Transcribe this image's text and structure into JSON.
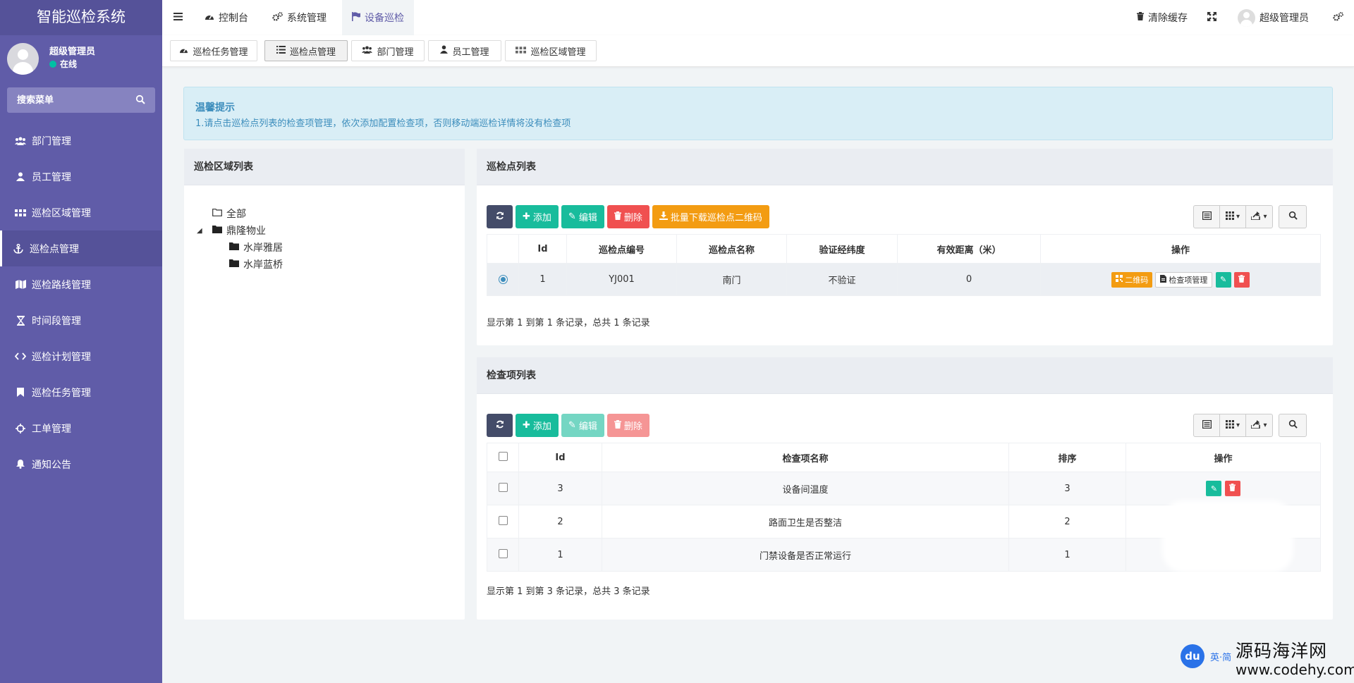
{
  "brand": {
    "title": "智能巡检系统"
  },
  "user": {
    "name": "超级管理员",
    "status": "在线"
  },
  "sidebar": {
    "search_placeholder": "搜索菜单",
    "items": [
      {
        "label": "部门管理",
        "icon": "users-icon"
      },
      {
        "label": "员工管理",
        "icon": "user-icon"
      },
      {
        "label": "巡检区域管理",
        "icon": "grid-icon"
      },
      {
        "label": "巡检点管理",
        "icon": "anchor-icon",
        "active": true
      },
      {
        "label": "巡检路线管理",
        "icon": "map-icon"
      },
      {
        "label": "时间段管理",
        "icon": "hourglass-icon"
      },
      {
        "label": "巡检计划管理",
        "icon": "code-icon"
      },
      {
        "label": "巡检任务管理",
        "icon": "bookmark-icon"
      },
      {
        "label": "工单管理",
        "icon": "crosshair-icon"
      },
      {
        "label": "通知公告",
        "icon": "bell-icon"
      }
    ]
  },
  "navbar": {
    "menu_items": [
      {
        "label": "控制台",
        "icon": "dashboard-icon"
      },
      {
        "label": "系统管理",
        "icon": "cogs-icon"
      },
      {
        "label": "设备巡检",
        "icon": "flag-icon"
      }
    ],
    "clear_cache": "清除缓存",
    "user": "超级管理员"
  },
  "tabs": [
    {
      "label": "巡检任务管理",
      "icon": "dashboard-icon"
    },
    {
      "label": "巡检点管理",
      "icon": "list-icon",
      "active": true
    },
    {
      "label": "部门管理",
      "icon": "users-icon"
    },
    {
      "label": "员工管理",
      "icon": "user-icon"
    },
    {
      "label": "巡检区域管理",
      "icon": "grid-icon"
    }
  ],
  "tip": {
    "title": "温馨提示",
    "content": "1.请点击巡检点列表的检查项管理，依次添加配置检查项，否则移动端巡检详情将没有检查项"
  },
  "area_panel": {
    "title": "巡检区域列表",
    "tree": {
      "root": "全部",
      "group": "鼎隆物业",
      "children": [
        "水岸雅居",
        "水岸蓝桥"
      ]
    }
  },
  "point_panel": {
    "title": "巡检点列表",
    "buttons": {
      "add": "添加",
      "edit": "编辑",
      "delete": "删除",
      "download": "批量下载巡检点二维码"
    },
    "columns": [
      "Id",
      "巡检点编号",
      "巡检点名称",
      "验证经纬度",
      "有效距离（米）",
      "操作"
    ],
    "rows": [
      {
        "id": "1",
        "code": "YJ001",
        "name": "南门",
        "verify": "不验证",
        "distance": "0"
      }
    ],
    "row_actions": {
      "qrcode": "二维码",
      "check": "检查项管理"
    },
    "footer": "显示第 1 到第 1 条记录，总共 1 条记录"
  },
  "check_panel": {
    "title": "检查项列表",
    "buttons": {
      "add": "添加",
      "edit": "编辑",
      "delete": "删除"
    },
    "columns": [
      "Id",
      "检查项名称",
      "排序",
      "操作"
    ],
    "rows": [
      {
        "id": "3",
        "name": "设备间温度",
        "sort": "3"
      },
      {
        "id": "2",
        "name": "路面卫生是否整洁",
        "sort": "2"
      },
      {
        "id": "1",
        "name": "门禁设备是否正常运行",
        "sort": "1"
      }
    ],
    "footer": "显示第 1 到第 3 条记录，总共 3 条记录"
  },
  "watermark": {
    "badge": "du",
    "badge_caption": "英·简",
    "site_name": "源码海洋网",
    "site_url": "www.codehy.com"
  },
  "colors": {
    "sidebar": "#605ca8",
    "teal": "#18bc9c",
    "red": "#f05050",
    "orange": "#f39c12",
    "dark": "#444c69",
    "info": "#3c8dbc"
  }
}
